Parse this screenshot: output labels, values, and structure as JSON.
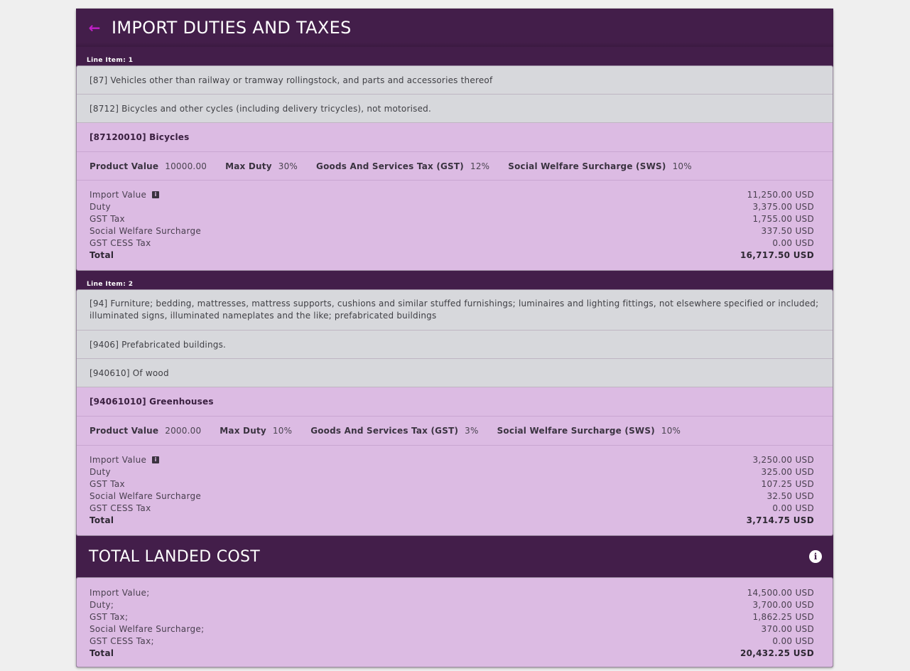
{
  "header": {
    "title": "IMPORT DUTIES AND TAXES",
    "back_icon": "arrow-left-icon"
  },
  "colors": {
    "header_bg": "#431e4a",
    "accent": "#c020c8",
    "category_bg": "#d7d8dc",
    "hs_bg": "#dcbbe3",
    "page_bg": "#efefef"
  },
  "line_items": [
    {
      "label": "Line Item: 1",
      "categories": [
        "[87] Vehicles other than railway or tramway rollingstock, and parts and accessories thereof",
        "[8712] Bicycles and other cycles (including delivery tricycles), not motorised."
      ],
      "hs_code": "[87120010] Bicycles",
      "params": [
        {
          "label": "Product Value",
          "value": "10000.00"
        },
        {
          "label": "Max Duty",
          "value": "30%"
        },
        {
          "label": "Goods And Services Tax (GST)",
          "value": "12%"
        },
        {
          "label": "Social Welfare Surcharge (SWS)",
          "value": "10%"
        }
      ],
      "summary": [
        {
          "label": "Import Value",
          "value": "11,250.00 USD",
          "info": true
        },
        {
          "label": "Duty",
          "value": "3,375.00 USD"
        },
        {
          "label": "GST Tax",
          "value": "1,755.00 USD"
        },
        {
          "label": "Social Welfare Surcharge",
          "value": "337.50 USD"
        },
        {
          "label": "GST CESS Tax",
          "value": "0.00 USD"
        },
        {
          "label": "Total",
          "value": "16,717.50 USD",
          "bold": true
        }
      ]
    },
    {
      "label": "Line Item: 2",
      "categories": [
        "[94] Furniture; bedding, mattresses, mattress supports, cushions and similar stuffed furnishings; luminaires and lighting fittings, not elsewhere specified or included; illuminated signs, illuminated nameplates and the like; prefabricated buildings",
        "[9406] Prefabricated buildings.",
        "[940610] Of wood"
      ],
      "hs_code": "[94061010] Greenhouses",
      "params": [
        {
          "label": "Product Value",
          "value": "2000.00"
        },
        {
          "label": "Max Duty",
          "value": "10%"
        },
        {
          "label": "Goods And Services Tax (GST)",
          "value": "3%"
        },
        {
          "label": "Social Welfare Surcharge (SWS)",
          "value": "10%"
        }
      ],
      "summary": [
        {
          "label": "Import Value",
          "value": "3,250.00 USD",
          "info": true
        },
        {
          "label": "Duty",
          "value": "325.00 USD"
        },
        {
          "label": "GST Tax",
          "value": "107.25 USD"
        },
        {
          "label": "Social Welfare Surcharge",
          "value": "32.50 USD"
        },
        {
          "label": "GST CESS Tax",
          "value": "0.00 USD"
        },
        {
          "label": "Total",
          "value": "3,714.75 USD",
          "bold": true
        }
      ]
    }
  ],
  "landed_cost": {
    "title": "TOTAL LANDED COST",
    "info_icon": "info-circle-icon",
    "rows": [
      {
        "label": "Import Value;",
        "value": "14,500.00 USD"
      },
      {
        "label": "Duty;",
        "value": "3,700.00 USD"
      },
      {
        "label": "GST Tax;",
        "value": "1,862.25 USD"
      },
      {
        "label": "Social Welfare Surcharge;",
        "value": "370.00 USD"
      },
      {
        "label": "GST CESS Tax;",
        "value": "0.00 USD"
      },
      {
        "label": "Total",
        "value": "20,432.25 USD",
        "bold": true
      }
    ]
  }
}
